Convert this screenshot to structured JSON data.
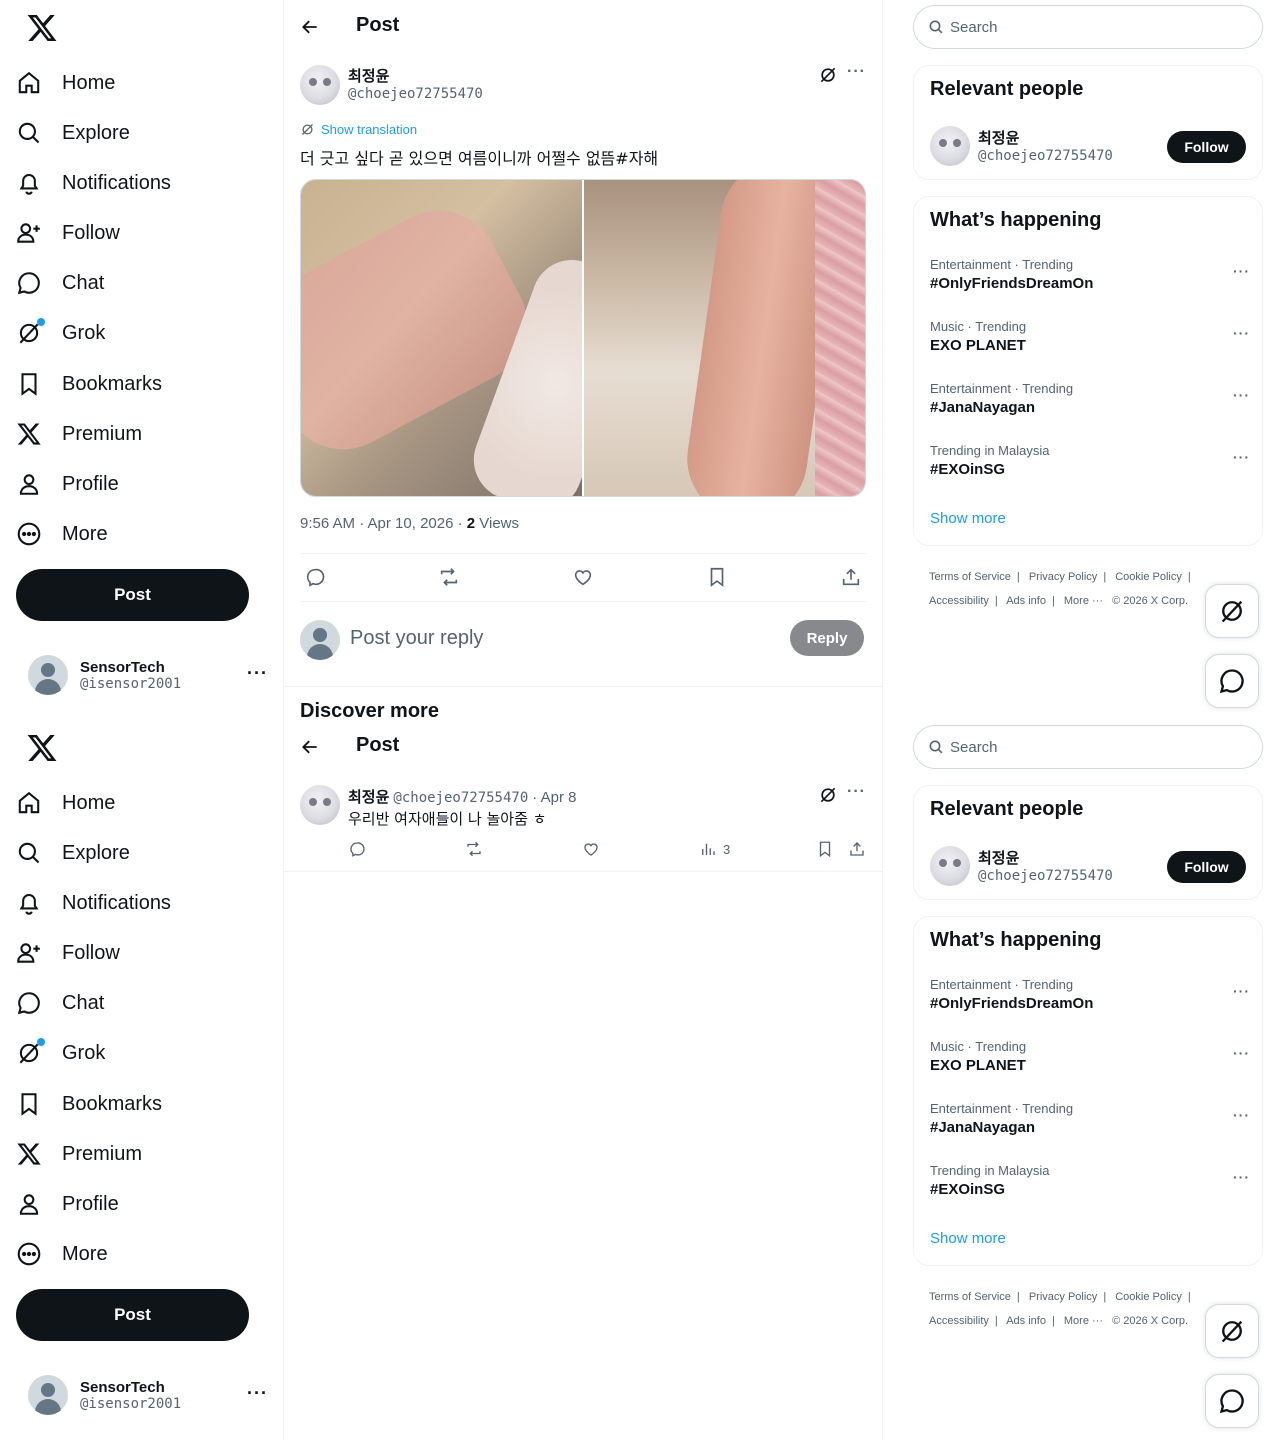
{
  "nav": {
    "items": [
      {
        "label": "Home",
        "icon": "home-icon"
      },
      {
        "label": "Explore",
        "icon": "search-icon"
      },
      {
        "label": "Notifications",
        "icon": "bell-icon"
      },
      {
        "label": "Follow",
        "icon": "person-add-icon"
      },
      {
        "label": "Chat",
        "icon": "chat-bubble-icon"
      },
      {
        "label": "Grok",
        "icon": "grok-icon"
      },
      {
        "label": "Bookmarks",
        "icon": "bookmark-icon"
      },
      {
        "label": "Premium",
        "icon": "x-logo-icon"
      },
      {
        "label": "Profile",
        "icon": "person-icon"
      },
      {
        "label": "More",
        "icon": "more-circle-icon"
      }
    ],
    "post_label": "Post",
    "account": {
      "name": "SensorTech",
      "handle": "@isensor2001"
    }
  },
  "header": {
    "title": "Post"
  },
  "post": {
    "author_name": "최정윤",
    "author_handle": "@choejeo72755470",
    "show_translation": "Show translation",
    "text": "더 긋고 싶다 곧 있으면 여름이니까 어쩔수 없뜸#자해",
    "timestamp": "9:56 AM · Apr 10, 2026 · ",
    "views_count": "2",
    "views_label": " Views"
  },
  "reply": {
    "placeholder": "Post your reply",
    "button": "Reply"
  },
  "discover": {
    "title": "Discover more"
  },
  "related_tweet": {
    "author_name": "최정윤",
    "author_handle": "@choejeo72755470",
    "date": "· Apr 8",
    "text": "우리반 여자애들이 나 놀아줌 ㅎ",
    "views": "3"
  },
  "sidebar": {
    "search_placeholder": "Search",
    "relevant_people": {
      "title": "Relevant people",
      "name": "최정윤",
      "handle": "@choejeo72755470",
      "follow": "Follow"
    },
    "happening": {
      "title": "What’s happening",
      "trends": [
        {
          "category": "Entertainment · Trending",
          "title": "#OnlyFriendsDreamOn"
        },
        {
          "category": "Music · Trending",
          "title": "EXO PLANET"
        },
        {
          "category": "Entertainment · Trending",
          "title": "#JanaNayagan"
        },
        {
          "category": "Trending in Malaysia",
          "title": "#EXOinSG"
        }
      ],
      "show_more": "Show more"
    },
    "footer": {
      "terms": "Terms of Service",
      "privacy": "Privacy Policy",
      "cookie": "Cookie Policy",
      "accessibility": "Accessibility",
      "ads": "Ads info",
      "more": "More ···",
      "copyright": "© 2026 X Corp."
    }
  },
  "colors": {
    "accent": "#1d9bf0",
    "text": "#0f1419",
    "muted": "#536471",
    "border": "#eff3f4"
  }
}
